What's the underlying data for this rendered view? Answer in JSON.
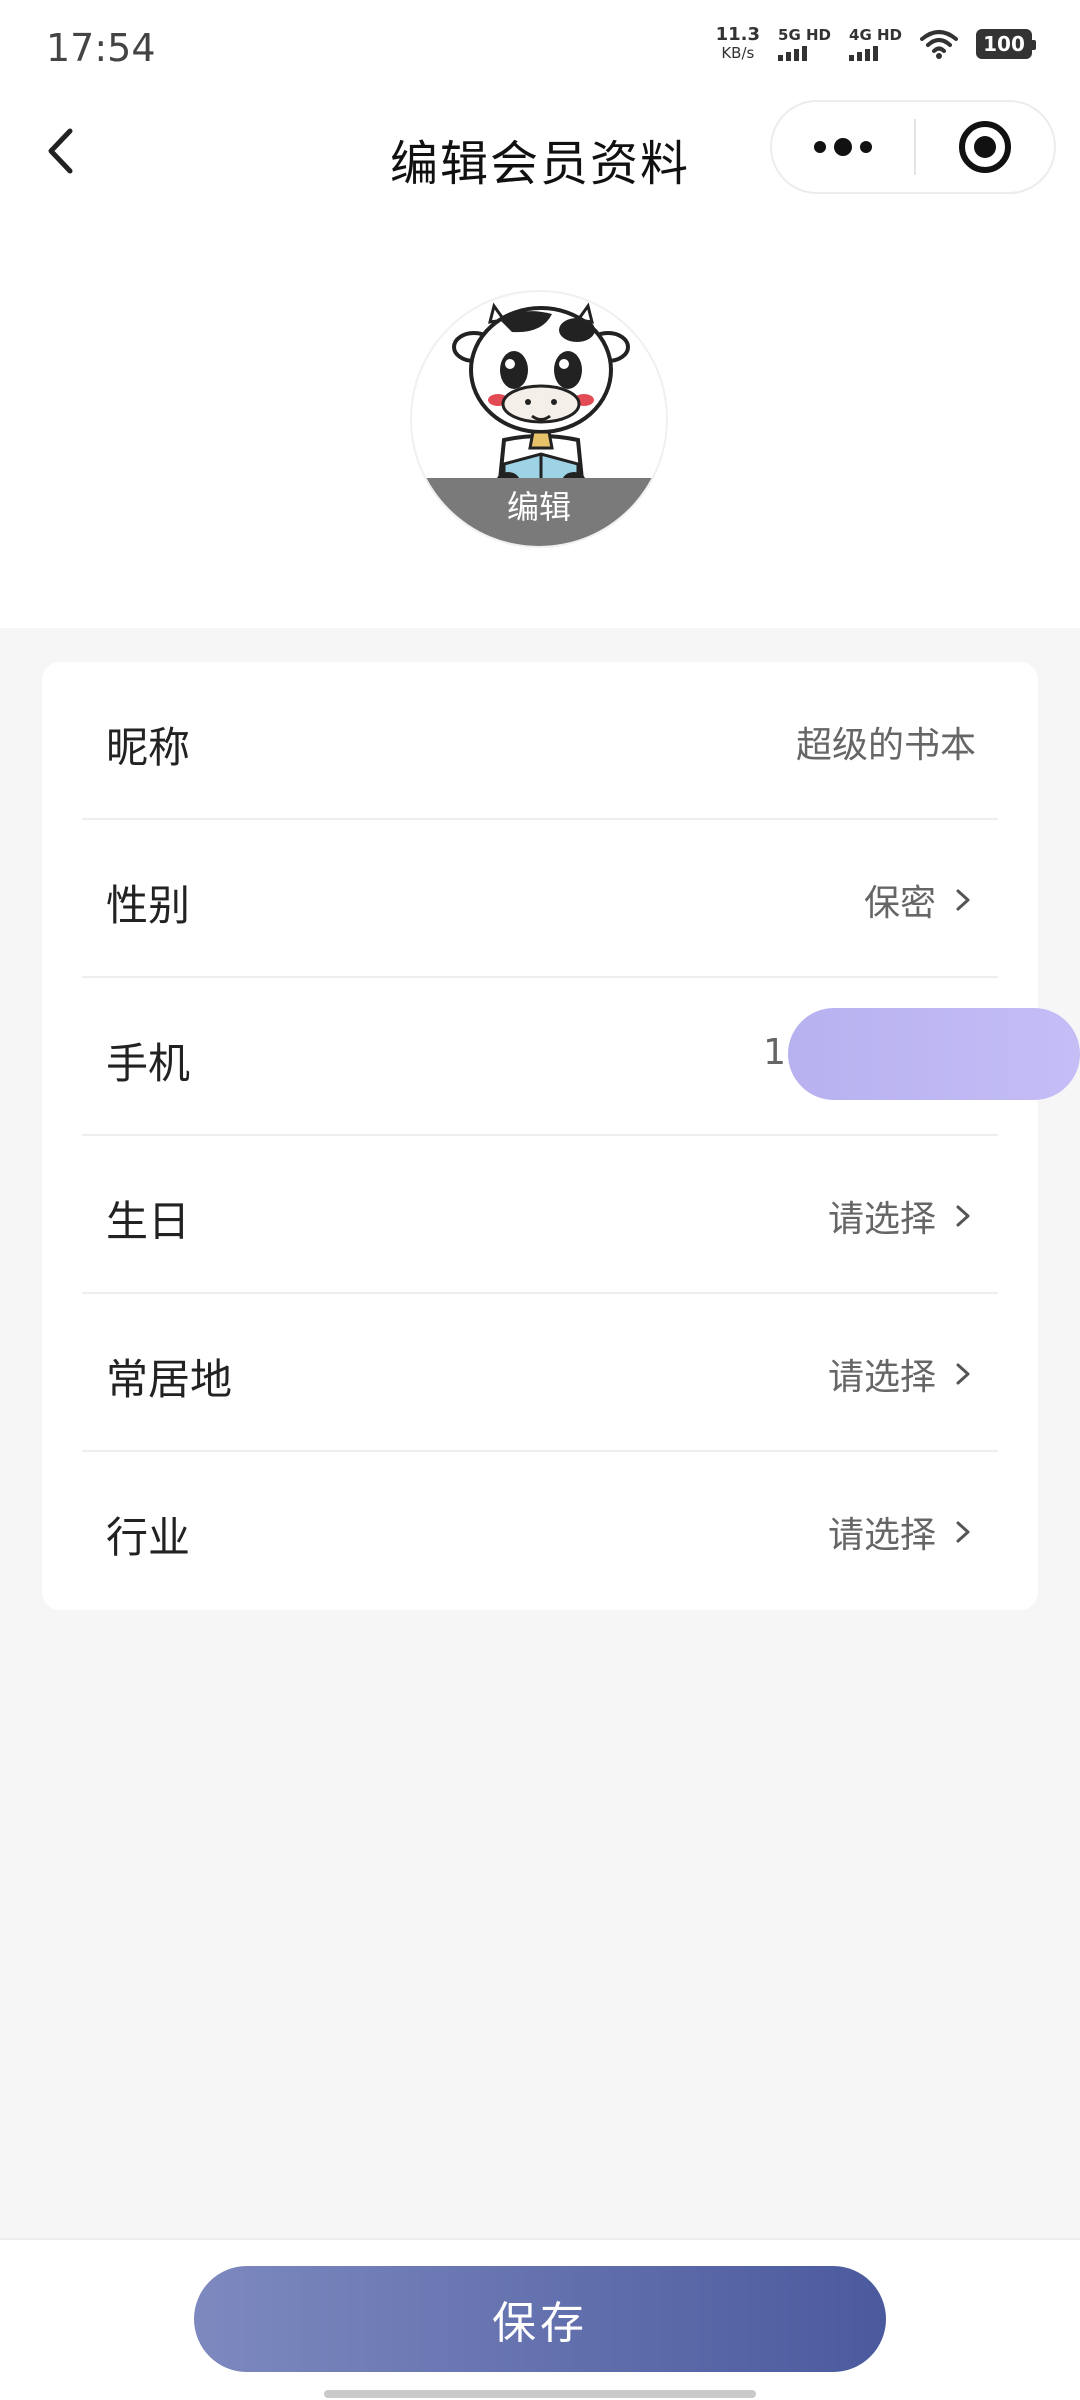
{
  "status_bar": {
    "time": "17:54",
    "net_speed_value": "11.3",
    "net_speed_unit": "KB/s",
    "sim1_label": "5G HD",
    "sim2_label": "4G HD",
    "battery": "100"
  },
  "nav": {
    "title": "编辑会员资料",
    "back_icon": "chevron-left-icon",
    "more_icon": "more-dots-icon",
    "close_icon": "target-close-icon"
  },
  "avatar": {
    "edit_label": "编辑"
  },
  "form": {
    "rows": [
      {
        "label": "昵称",
        "value": "超级的书本",
        "has_chevron": false
      },
      {
        "label": "性别",
        "value": "保密",
        "has_chevron": true
      },
      {
        "label": "手机",
        "value": "1",
        "has_chevron": false,
        "masked": true
      },
      {
        "label": "生日",
        "value": "请选择",
        "has_chevron": true
      },
      {
        "label": "常居地",
        "value": "请选择",
        "has_chevron": true
      },
      {
        "label": "行业",
        "value": "请选择",
        "has_chevron": true
      }
    ]
  },
  "footer": {
    "save_label": "保存"
  },
  "colors": {
    "accent_start": "#7d89bf",
    "accent_end": "#4b5a9e",
    "mask": "#b7b1f0"
  }
}
